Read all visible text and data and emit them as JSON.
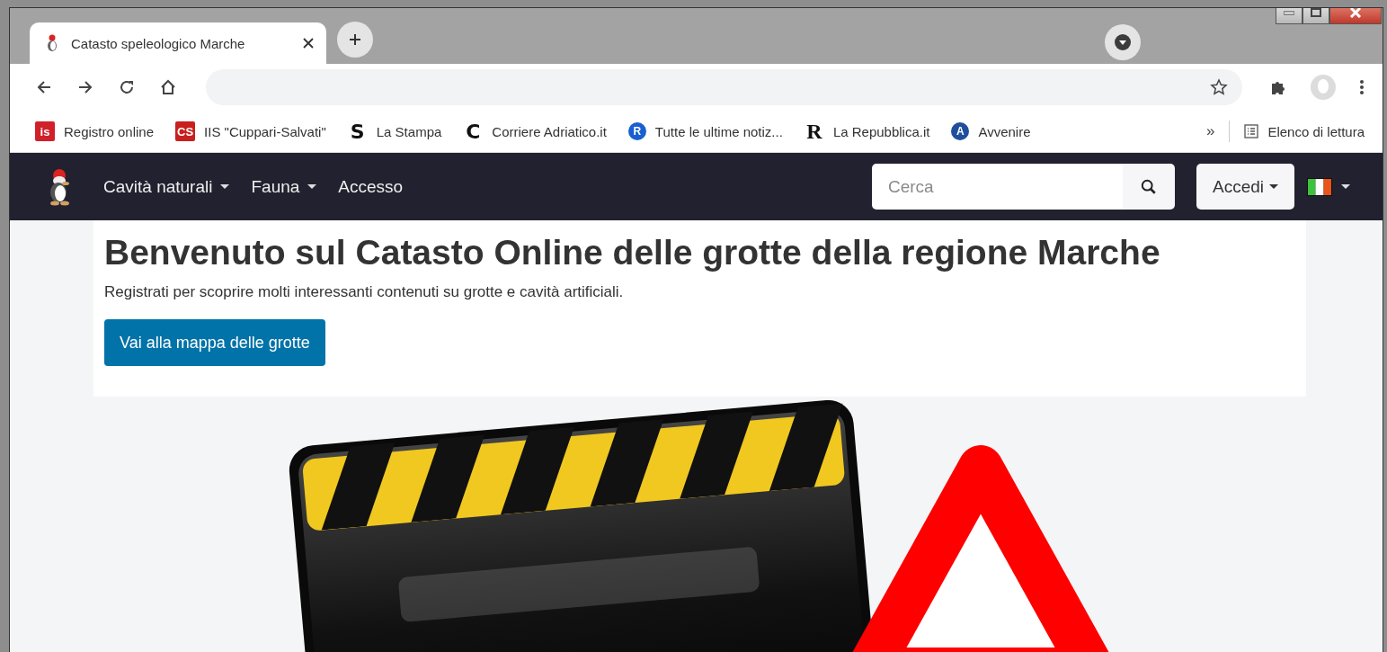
{
  "browser": {
    "tabs": [
      {
        "title": "Catasto speleologico Marche",
        "selected": true
      }
    ],
    "bookmarks": [
      {
        "label": "Registro online",
        "favicon": {
          "kind": "square",
          "text": "is",
          "color": "#d0202a"
        }
      },
      {
        "label": "IIS \"Cuppari-Salvati\"",
        "favicon": {
          "kind": "square",
          "text": "CS",
          "color": "#c8201e"
        }
      },
      {
        "label": "La Stampa",
        "favicon": {
          "kind": "letter",
          "text": "S",
          "color": "#111111"
        }
      },
      {
        "label": "Corriere Adriatico.it",
        "favicon": {
          "kind": "letter",
          "text": "C",
          "color": "#111111"
        }
      },
      {
        "label": "Tutte le ultime notiz...",
        "favicon": {
          "kind": "circle",
          "text": "R",
          "color": "#1a5fd0"
        }
      },
      {
        "label": "La Repubblica.it",
        "favicon": {
          "kind": "serif",
          "text": "R",
          "color": "#111111"
        }
      },
      {
        "label": "Avvenire",
        "favicon": {
          "kind": "circle",
          "text": "A",
          "color": "#1f4f9c"
        }
      }
    ],
    "bookmarks_overflow": "»",
    "reading_list": "Elenco di lettura"
  },
  "site": {
    "nav_items": [
      {
        "label": "Cavità naturali",
        "dropdown": true
      },
      {
        "label": "Fauna",
        "dropdown": true
      },
      {
        "label": "Accesso",
        "dropdown": false
      }
    ],
    "search": {
      "placeholder": "Cerca"
    },
    "login_button": "Accedi",
    "heading": "Benvenuto sul Catasto Online delle grotte della regione Marche",
    "intro": "Registrati per scoprire molti interessanti contenuti su grotte e cavità artificiali.",
    "map_button": "Vai alla mappa delle grotte"
  }
}
